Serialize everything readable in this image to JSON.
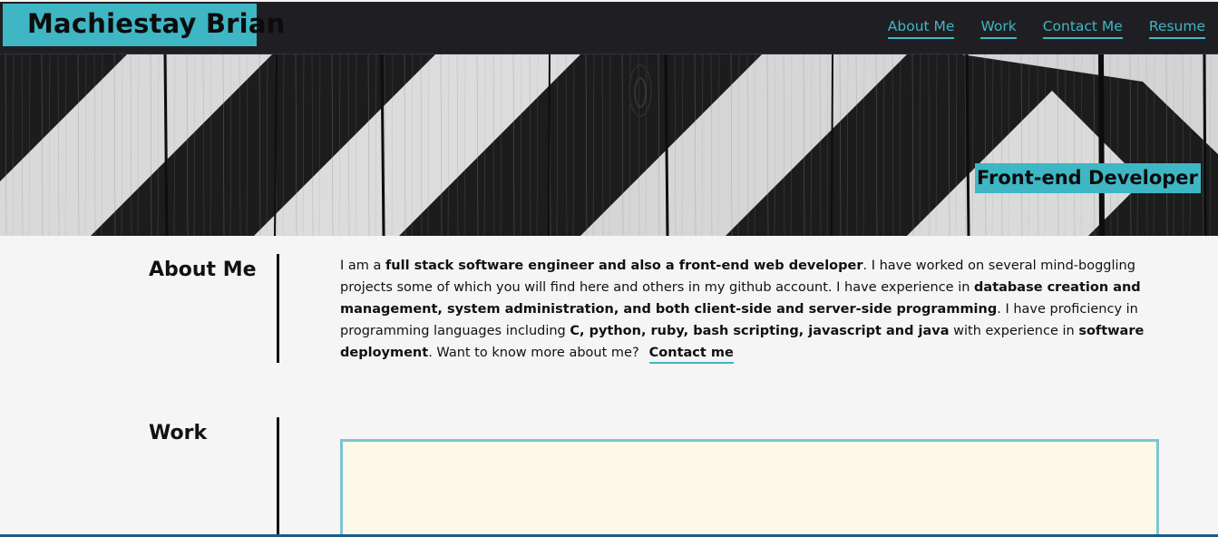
{
  "header": {
    "brand": "Machiestay Brian",
    "nav": [
      {
        "label": "About Me"
      },
      {
        "label": "Work"
      },
      {
        "label": "Contact Me"
      },
      {
        "label": "Resume"
      }
    ]
  },
  "hero": {
    "tagline": "Front-end Developer"
  },
  "about": {
    "title": "About Me",
    "p1": "I am a ",
    "b1": "full stack software engineer and also a front-end web developer",
    "p2": ". I have worked on several mind-boggling projects some of which you will find here and others in my github account. I have experience in ",
    "b2": "database creation and management, system administration, and both client-side and server-side programming",
    "p3": ". I have proficiency in programming languages including ",
    "b3": "C, python, ruby, bash scripting, javascript and java",
    "p4": " with experience in ",
    "b4": "software deployment",
    "p5": ". Want to know more about me?",
    "contact_link": "Contact me"
  },
  "work": {
    "title": "Work"
  },
  "colors": {
    "accent": "#3fb6c4",
    "navbar": "#1f1f23",
    "page_bg": "#f5f5f5"
  }
}
